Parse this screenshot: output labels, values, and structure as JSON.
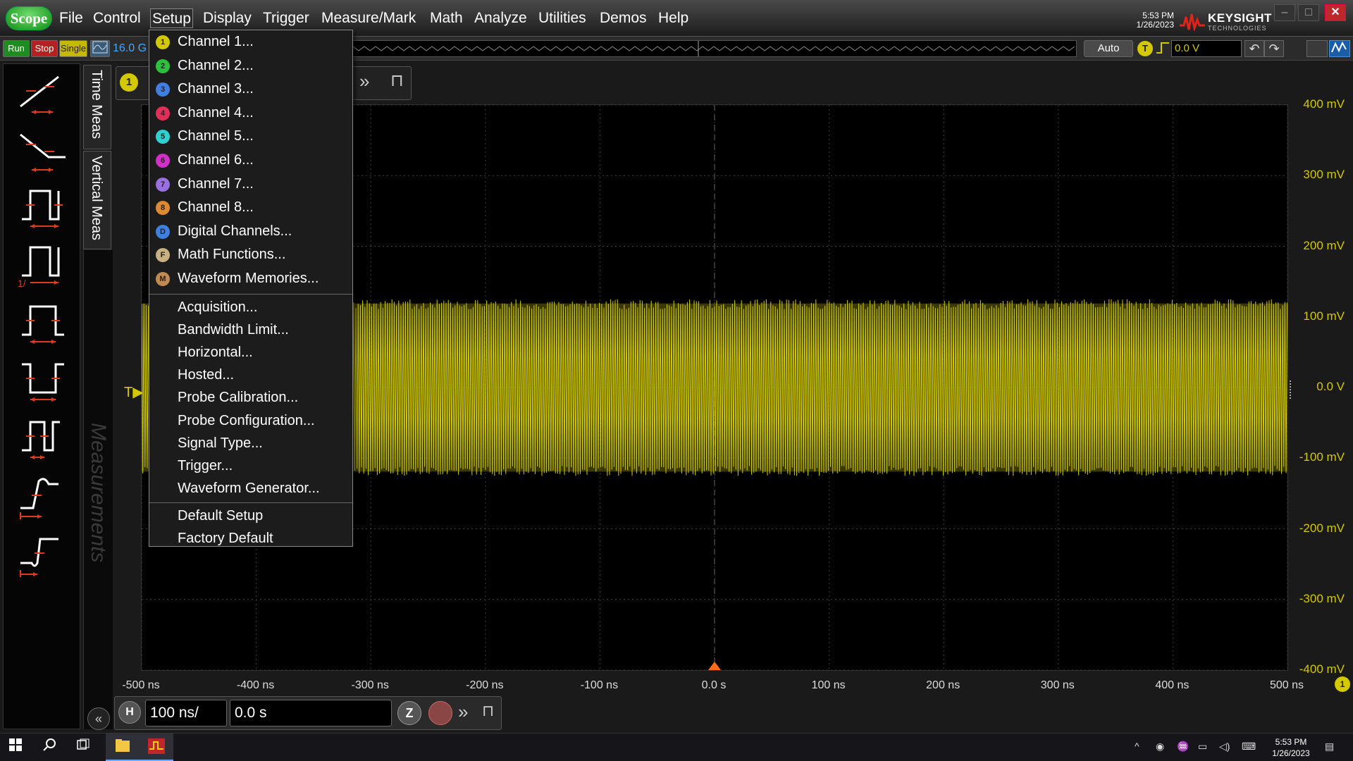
{
  "app": {
    "logo": "Scope",
    "menus": [
      "File",
      "Control",
      "Setup",
      "Display",
      "Trigger",
      "Measure/Mark",
      "Math",
      "Analyze",
      "Utilities",
      "Demos",
      "Help"
    ],
    "active_menu": "Setup",
    "clock_time": "5:53 PM",
    "clock_date": "1/26/2023",
    "brand": "KEYSIGHT",
    "brand_sub": "TECHNOLOGIES"
  },
  "toolbar": {
    "run": "Run",
    "stop": "Stop",
    "single": "Single",
    "sample_rate": "16.0 G",
    "auto": "Auto",
    "trigger_badge": "T",
    "trigger_level": "0.0 V"
  },
  "side_tabs": {
    "time_meas": "Time Meas",
    "vertical_meas": "Vertical Meas",
    "measurements": "Measurements"
  },
  "channel_badge": "1",
  "setup_menu": {
    "channels": [
      {
        "label": "Channel 1...",
        "badge": "1",
        "color": "#d4c900"
      },
      {
        "label": "Channel 2...",
        "badge": "2",
        "color": "#2fbf3f"
      },
      {
        "label": "Channel 3...",
        "badge": "3",
        "color": "#3f7fe0"
      },
      {
        "label": "Channel 4...",
        "badge": "4",
        "color": "#e0305a"
      },
      {
        "label": "Channel 5...",
        "badge": "5",
        "color": "#2fd0d0"
      },
      {
        "label": "Channel 6...",
        "badge": "6",
        "color": "#d030c8"
      },
      {
        "label": "Channel 7...",
        "badge": "7",
        "color": "#9a6fe0"
      },
      {
        "label": "Channel 8...",
        "badge": "8",
        "color": "#e08a2f"
      },
      {
        "label": "Digital Channels...",
        "badge": "D",
        "color": "#3f7fe0"
      },
      {
        "label": "Math Functions...",
        "badge": "F",
        "color": "#c8b080"
      },
      {
        "label": "Waveform Memories...",
        "badge": "M",
        "color": "#c08a50"
      }
    ],
    "settings": [
      "Acquisition...",
      "Bandwidth Limit...",
      "Horizontal...",
      "Hosted...",
      "Probe Calibration...",
      "Probe Configuration...",
      "Signal Type...",
      "Trigger...",
      "Waveform Generator..."
    ],
    "defaults": [
      "Default Setup",
      "Factory Default"
    ]
  },
  "chart_data": {
    "type": "line",
    "title": "",
    "xlabel": "",
    "ylabel": "",
    "x_ticks": [
      "-500 ns",
      "-400 ns",
      "-300 ns",
      "-200 ns",
      "-100 ns",
      "0.0 s",
      "100 ns",
      "200 ns",
      "300 ns",
      "400 ns",
      "500 ns"
    ],
    "y_ticks": [
      "400 mV",
      "300 mV",
      "200 mV",
      "100 mV",
      "0.0 V",
      "-100 mV",
      "-200 mV",
      "-300 mV",
      "-400 mV"
    ],
    "xlim_ns": [
      -500,
      500
    ],
    "ylim_mV": [
      -400,
      400
    ],
    "grid": true,
    "series": [
      {
        "color": "#e6e000",
        "envelope_max_mV": 125,
        "envelope_min_mV": -125,
        "x_start_ns": -500,
        "x_end_ns": 500
      }
    ]
  },
  "horizontal": {
    "badge": "H",
    "scale": "100 ns/",
    "position": "0.0 s",
    "zoom": "Z"
  },
  "taskbar": {
    "time": "5:53 PM",
    "date": "1/26/2023"
  }
}
